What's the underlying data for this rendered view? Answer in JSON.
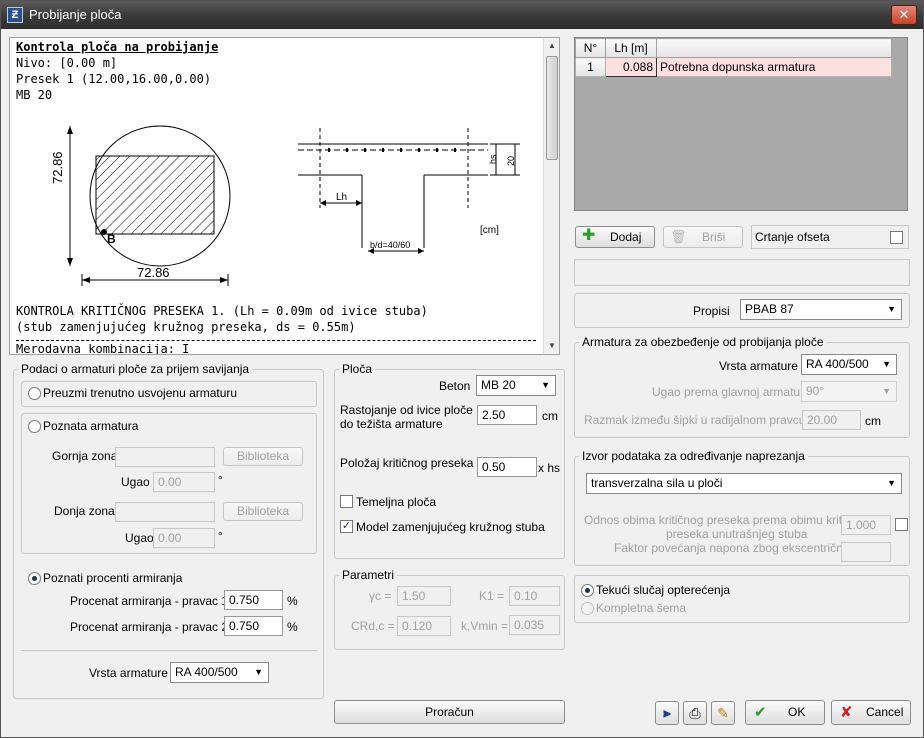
{
  "window": {
    "title": "Probijanje ploča"
  },
  "report": {
    "lines": [
      "Kontrola ploča na probijanje",
      "Nivo: [0.00 m]",
      "Presek 1 (12.00,16.00,0.00)",
      "MB 20"
    ],
    "circle_dim_v": "72.86",
    "circle_dim_h": "72.86",
    "circle_point": "B",
    "section": {
      "lh": "Lh",
      "hs": "hs",
      "h20": "20",
      "bd": "b/d=40/60",
      "unit": "[cm]"
    },
    "line_kontrola": "KONTROLA KRITIČNOG PRESEKA 1. (Lh = 0.09m od ivice stuba)",
    "line_stub": "(stub zamenjujućeg kružnog preseka, ds = 0.55m)",
    "line_cut": "Merodavna kombinacija: I"
  },
  "table": {
    "headers": [
      "N°",
      "Lh [m]",
      ""
    ],
    "rows": [
      {
        "no": "1",
        "lh": "0.088",
        "note": "Potrebna dopunska armatura"
      }
    ]
  },
  "actions": {
    "add": "Dodaj",
    "delete": "Briši",
    "offset_label": "Crtanje ofseta"
  },
  "left": {
    "group_title": "Podaci o armaturi ploče za prijem savijanja",
    "opt_current": "Preuzmi trenutno usvojenu armaturu",
    "opt_known": "Poznata armatura",
    "top_zone": "Gornja zona",
    "bottom_zone": "Donja zona",
    "library": "Biblioteka",
    "angle": "Ugao",
    "angle_value": "0.00",
    "degree": "°",
    "opt_percent": "Poznati procenti armiranja",
    "pct1_label": "Procenat armiranja - pravac 1",
    "pct1_value": "0.750",
    "pct2_label": "Procenat armiranja - pravac 2",
    "pct2_value": "0.750",
    "percent_unit": "%",
    "rebar_label": "Vrsta armature",
    "rebar_value": "RA 400/500"
  },
  "ploca": {
    "title": "Ploča",
    "beton_label": "Beton",
    "beton_value": "MB 20",
    "dist_label1": "Rastojanje od ivice ploče",
    "dist_label2": "do težišta armature",
    "dist_value": "2.50",
    "dist_unit": "cm",
    "crit_label": "Položaj kritičnog preseka",
    "crit_value": "0.50",
    "crit_unit": "x hs",
    "foundation": "Temeljna ploča",
    "model": "Model zamenjujućeg kružnog stuba"
  },
  "params": {
    "title": "Parametri",
    "yc_label": "γc =",
    "yc_value": "1.50",
    "k1_label": "K1 =",
    "k1_value": "0.10",
    "crd_label": "CRd,c =",
    "crd_value": "0.120",
    "kv_label": "k,Vmin =",
    "kv_value": "0.035"
  },
  "compute": "Proračun",
  "right": {
    "propisi_label": "Propisi",
    "propisi_value": "PBAB 87",
    "arm_title": "Armatura za obezbeđenje od probijanja ploče",
    "vrsta_label": "Vrsta armature",
    "vrsta_value": "RA 400/500",
    "ugao_label": "Ugao prema glavnoj armaturi",
    "ugao_value": "90°",
    "razmak_label": "Razmak između šipki u radijalnom pravcu",
    "razmak_value": "20.00",
    "razmak_unit": "cm",
    "izvor_title": "Izvor podataka za određivanje naprezanja",
    "izvor_value": "transverzalna sila u ploči",
    "odnos_label1": "Odnos obima kritičnog preseka prema obimu kritičnog",
    "odnos_label2": "preseka unutrašnjeg stuba",
    "odnos_value": "1.000",
    "faktor_label": "Faktor povećanja napona zbog ekscentričnosti",
    "tekuci": "Tekući slučaj opterećenja",
    "kompletna": "Kompletna šema"
  },
  "footer": {
    "ok": "OK",
    "cancel": "Cancel"
  }
}
